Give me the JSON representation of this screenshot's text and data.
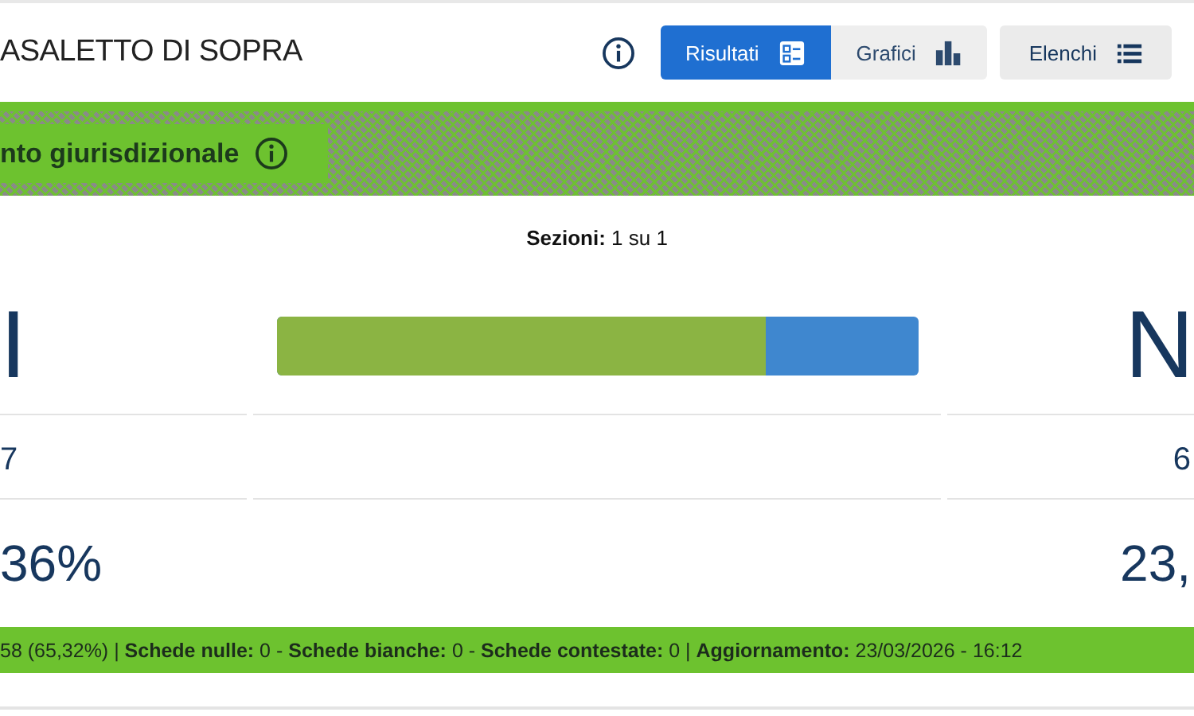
{
  "header": {
    "title": "ASALETTO DI SOPRA",
    "view_tabs": [
      {
        "label": "Risultati",
        "selected": true,
        "kind": "results"
      },
      {
        "label": "Grafici",
        "selected": false,
        "kind": "charts"
      }
    ],
    "buttons": [
      {
        "label": "Elenchi",
        "kind": "lists"
      }
    ]
  },
  "banner": {
    "label": "nto giurisdizionale"
  },
  "sections": "**Sezioni:** 1 su 1",
  "results": {
    "left": {
      "label": "I",
      "votes": "7",
      "percent": "36%"
    },
    "right": {
      "label": "N",
      "votes": "6",
      "percent": "23,"
    },
    "bar": {
      "level": 0.762
    }
  },
  "footer": "58 (65,32%) | **Schede nulle:** 0 - **Schede bianche:** 0 - **Schede contestate:** 0 | **Aggiornamento:** 23/03/2026 - 16:12"
}
